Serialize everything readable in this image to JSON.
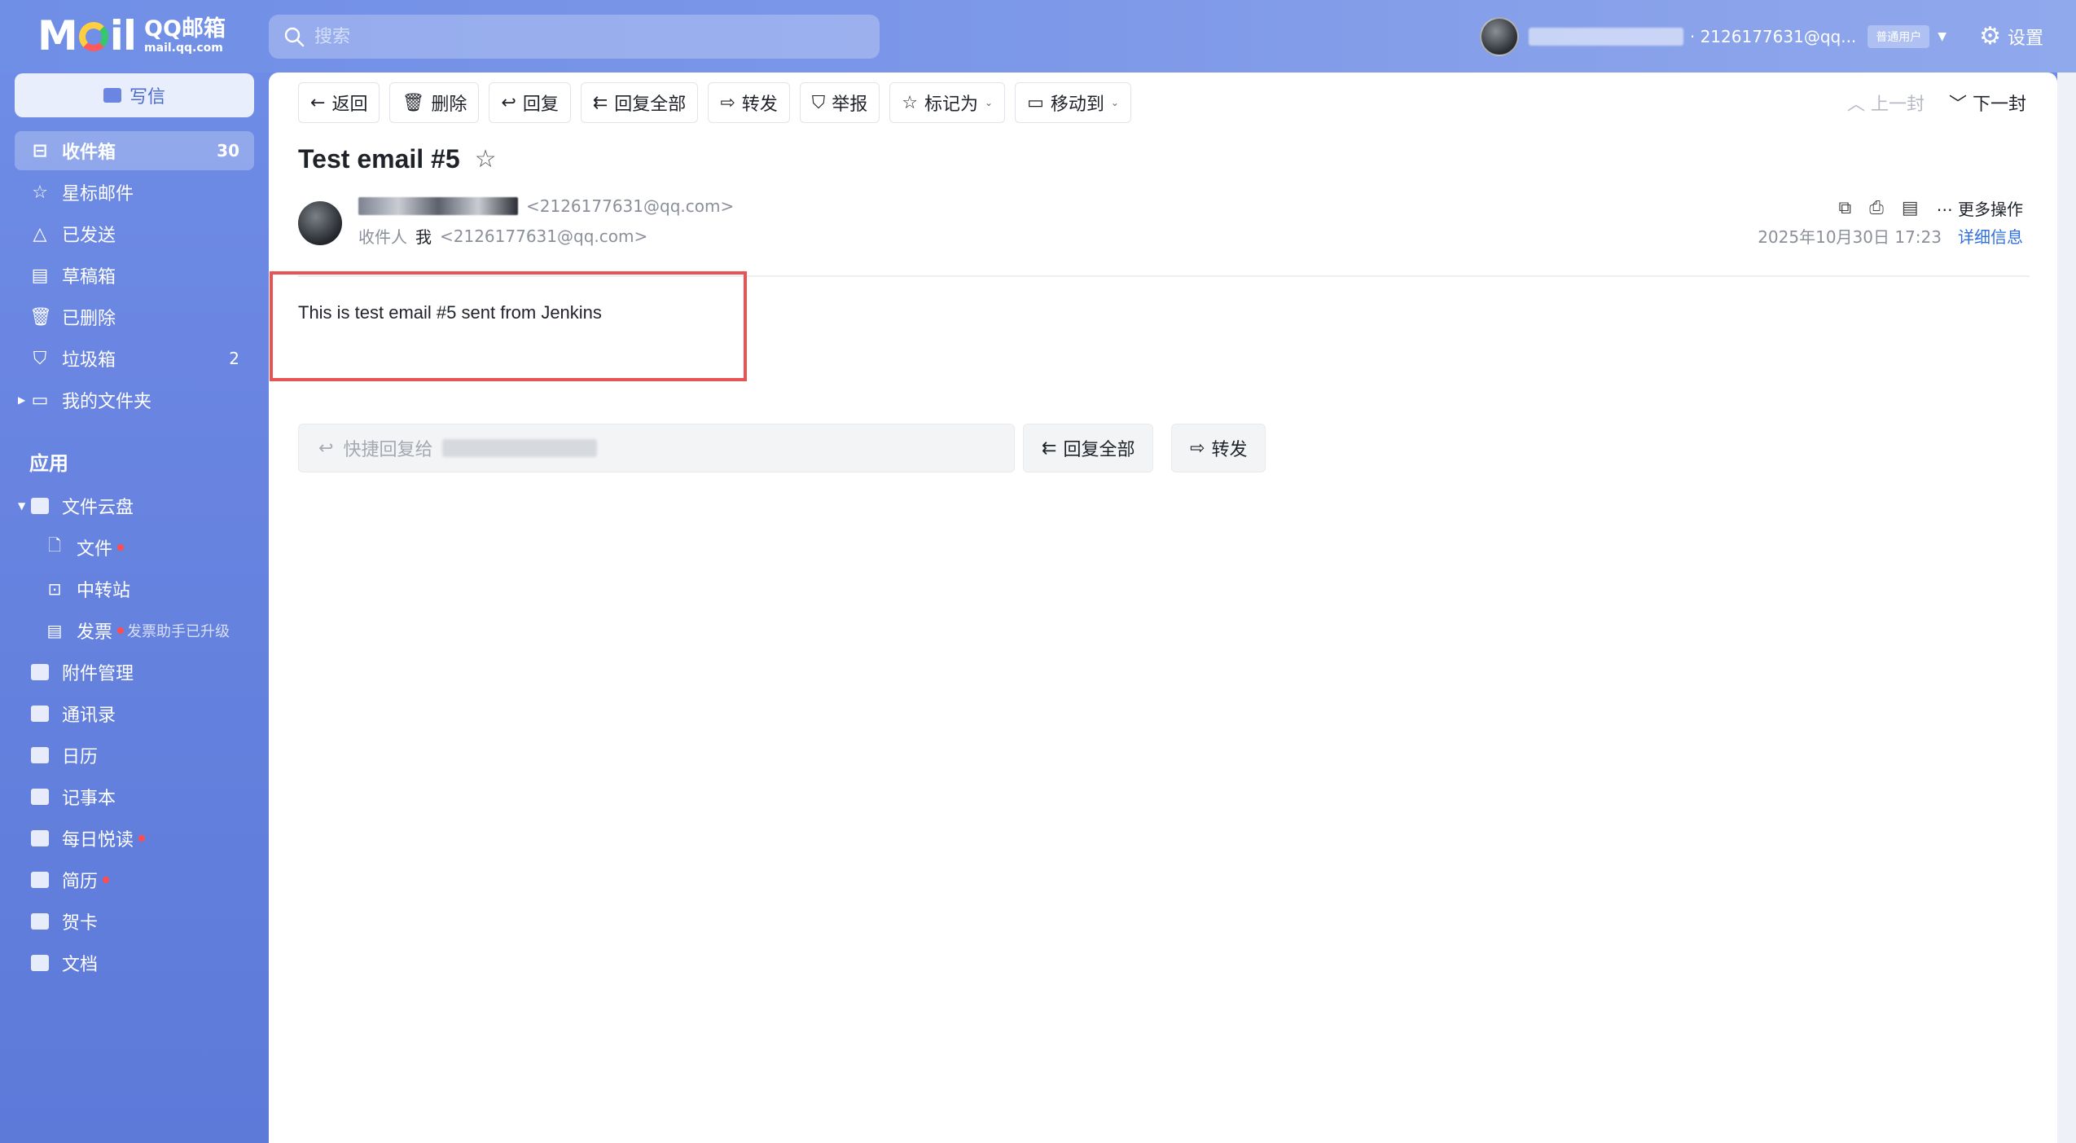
{
  "topbar": {
    "logo_text": "M  il",
    "logo_name": "QQ邮箱",
    "logo_domain": "mail.qq.com",
    "search_placeholder": "搜索",
    "user_email": "· 2126177631@qq...",
    "user_badge": "普通用户",
    "settings_label": "设置"
  },
  "sidebar": {
    "compose_label": "写信",
    "items": [
      {
        "label": "收件箱",
        "count": "30",
        "icon": "inbox-icon"
      },
      {
        "label": "星标邮件",
        "count": "",
        "icon": "star-icon"
      },
      {
        "label": "已发送",
        "count": "",
        "icon": "sent-icon"
      },
      {
        "label": "草稿箱",
        "count": "",
        "icon": "draft-icon"
      },
      {
        "label": "已删除",
        "count": "",
        "icon": "trash-icon"
      },
      {
        "label": "垃圾箱",
        "count": "2",
        "icon": "spam-shield-icon"
      },
      {
        "label": "我的文件夹",
        "count": "",
        "icon": "folder-icon"
      }
    ],
    "apps_title": "应用",
    "apps": [
      {
        "label": "文件云盘",
        "icon": "cloud-drive-icon"
      },
      {
        "label": "文件",
        "icon": "file-icon"
      },
      {
        "label": "中转站",
        "icon": "transfer-icon"
      },
      {
        "label": "发票",
        "icon": "invoice-icon",
        "hint": "发票助手已升级"
      },
      {
        "label": "附件管理",
        "icon": "attachment-icon"
      },
      {
        "label": "通讯录",
        "icon": "contacts-icon"
      },
      {
        "label": "日历",
        "icon": "calendar-icon"
      },
      {
        "label": "记事本",
        "icon": "notebook-icon"
      },
      {
        "label": "每日悦读",
        "icon": "reading-icon"
      },
      {
        "label": "简历",
        "icon": "resume-icon"
      },
      {
        "label": "贺卡",
        "icon": "card-icon"
      },
      {
        "label": "文档",
        "icon": "document-icon"
      }
    ]
  },
  "toolbar": {
    "back": "返回",
    "delete": "删除",
    "reply": "回复",
    "reply_all": "回复全部",
    "forward": "转发",
    "report": "举报",
    "mark_as": "标记为",
    "move_to": "移动到",
    "prev": "上一封",
    "next": "下一封"
  },
  "email": {
    "subject": "Test email #5",
    "sender_address": "<2126177631@qq.com>",
    "recipient_label": "收件人",
    "recipient_name": "我",
    "recipient_address": "<2126177631@qq.com>",
    "more_actions": "更多操作",
    "date": "2025年10月30日 17:23",
    "details": "详细信息",
    "body": "This is test email #5 sent from Jenkins"
  },
  "quick_reply": {
    "placeholder": "快捷回复给",
    "reply_all": "回复全部",
    "forward": "转发"
  },
  "colors": {
    "sidebar_bg": "#6a86e2",
    "highlight_border": "#e85454",
    "link": "#2f6fde"
  }
}
